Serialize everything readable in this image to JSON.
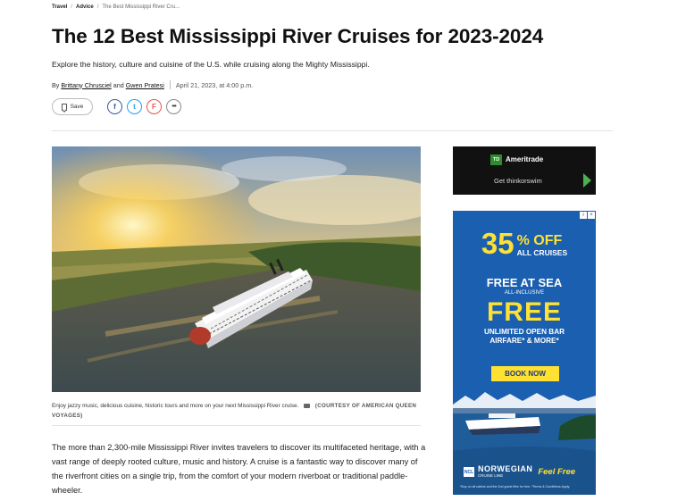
{
  "breadcrumb": {
    "items": [
      "Travel",
      "Advice"
    ],
    "separator": "/",
    "current": "The Best Mississippi River Cru..."
  },
  "article": {
    "title": "The 12 Best Mississippi River Cruises for 2023-2024",
    "subtitle": "Explore the history, culture and cuisine of the U.S. while cruising along the Mighty Mississippi.",
    "byline_prefix": "By",
    "author1": "Brittany Chrusciel",
    "and": "and",
    "author2": "Gwen Pratesi",
    "date": "April 21, 2023, at 4:00 p.m.",
    "caption": "Enjoy jazzy music, delicious cuisine, historic tours and more on your next Mississippi River cruise.",
    "credit": "(COURTESY OF AMERICAN QUEEN VOYAGES)",
    "body": "The more than 2,300-mile Mississippi River invites travelers to discover its multifaceted heritage, with a vast range of deeply rooted culture, music and history. A cruise is a fantastic way to discover many of the riverfront cities on a single trip, from the comfort of your modern riverboat or traditional paddle-wheeler."
  },
  "actions": {
    "save_label": "Save",
    "share": [
      {
        "icon": "facebook-icon",
        "glyph": "f"
      },
      {
        "icon": "twitter-icon",
        "glyph": "t"
      },
      {
        "icon": "flipboard-icon",
        "glyph": "F"
      },
      {
        "icon": "more-icon",
        "glyph": "•••"
      }
    ]
  },
  "ad_td": {
    "logo": "TD",
    "brand": "Ameritrade",
    "cta": "Get thinkorswim"
  },
  "ad_ncl": {
    "percent": "35",
    "percent_suffix": "% OFF",
    "all_cruises": "ALL CRUISES",
    "free_at_sea": "FREE AT SEA",
    "all_inclusive": "ALL-INCLUSIVE",
    "free": "FREE",
    "bar_line1": "UNLIMITED OPEN BAR",
    "bar_line2": "AIRFARE* & MORE*",
    "book_now": "BOOK NOW",
    "logo_mark": "NCL",
    "brand": "NORWEGIAN",
    "brand_sub": "CRUISE LINE",
    "tagline": "Feel Free",
    "fine_print": "*Buy on all cabins and the 2nd guest flies for free. *Terms & Conditions Apply.",
    "adchoices": [
      "i",
      "×"
    ]
  },
  "colors": {
    "ncl_blue": "#1b5fb0",
    "ncl_yellow": "#ffe033",
    "td_green": "#2e8b2e",
    "facebook": "#3b5998",
    "twitter": "#1da1f2",
    "flipboard": "#e8524f"
  }
}
